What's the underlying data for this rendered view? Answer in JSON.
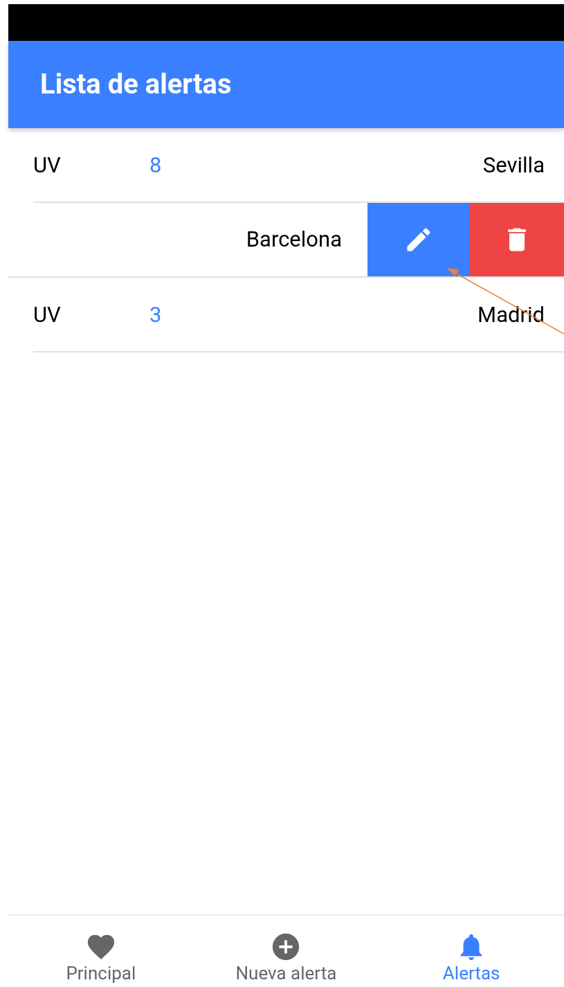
{
  "app_bar": {
    "title": "Lista de alertas"
  },
  "alerts": [
    {
      "kind": "normal",
      "label": "UV",
      "value": "8",
      "city": "Sevilla"
    },
    {
      "kind": "swiped",
      "city": "Barcelona"
    },
    {
      "kind": "normal",
      "label": "UV",
      "value": "3",
      "city": "Madrid"
    }
  ],
  "bottom_nav": [
    {
      "kind": "heart",
      "label": "Principal",
      "selected": false
    },
    {
      "kind": "plus",
      "label": "Nueva alerta",
      "selected": false
    },
    {
      "kind": "bell",
      "label": "Alertas",
      "selected": true
    }
  ]
}
